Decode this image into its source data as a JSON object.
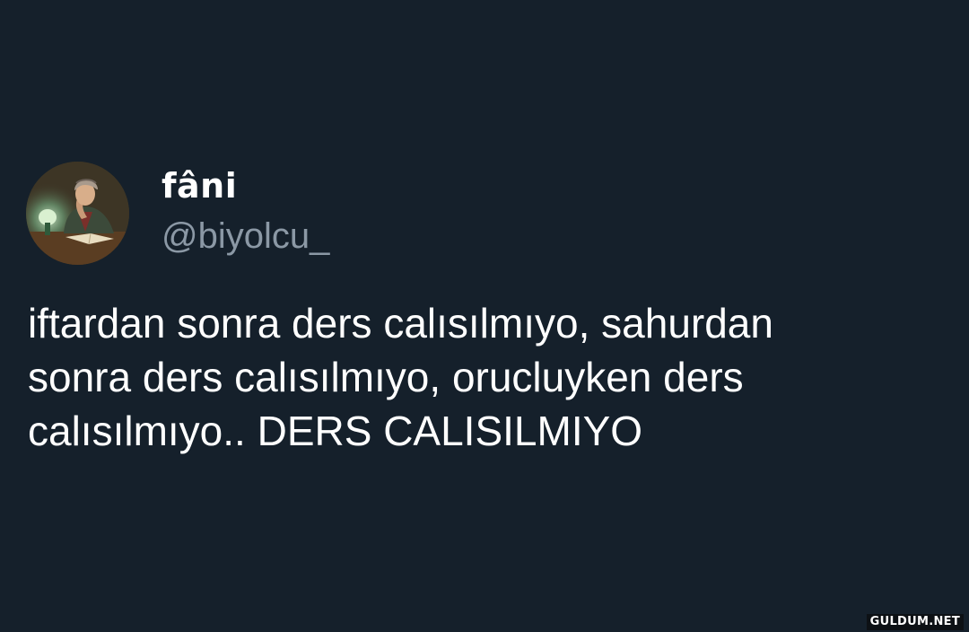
{
  "user": {
    "display_name": "fâni",
    "handle": "@biyolcu_",
    "avatar": "avatar-painting-woman-reading-icon"
  },
  "tweet": {
    "lines": [
      "iftardan sonra ders calısılmıyo, sahurdan",
      "sonra ders calısılmıyo, orucluyken ders",
      "calısılmıyo.. DERS CALISILMIYO"
    ]
  },
  "watermark": "GULDUM.NET",
  "colors": {
    "background": "#15202b",
    "text": "#ffffff",
    "secondary_text": "#8b98a5"
  }
}
